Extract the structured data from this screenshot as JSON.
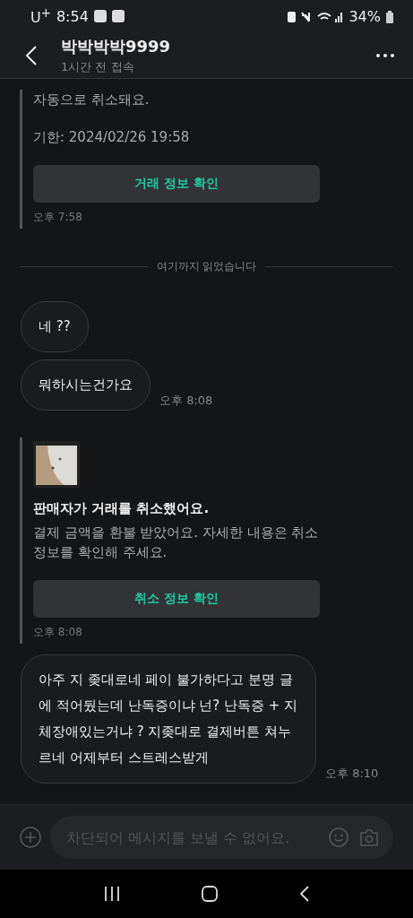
{
  "status_bar": {
    "carrier": "U$^{+}$",
    "time": "8:54",
    "battery": "34%"
  },
  "header": {
    "title": "박박박박9999",
    "subtitle": "1시간 전 접속"
  },
  "messages": [
    {
      "kind": "card",
      "body": [
        "자동으로 취소돼요.",
        "기한: 2024/02/26 19:58"
      ],
      "button": "거래 정보 확인",
      "time": "오후 7:58"
    },
    {
      "kind": "divider",
      "text": "여기까지 읽었습니다"
    },
    {
      "kind": "bubble",
      "text": "네 ??"
    },
    {
      "kind": "bubble",
      "text": "뭐하시는건가요",
      "time": "오후 8:08"
    },
    {
      "kind": "card",
      "thumbnail": {
        "kind": "picture"
      },
      "title": "판매자가 거래를 취소했어요.",
      "body": [
        "결제 금액을 환불 받았어요. 자세한 내용은 취소 정보를 확인해 주세요."
      ],
      "button": "취소 정보 확인",
      "time": "오후 8:08"
    },
    {
      "kind": "bubble",
      "text": "아주 지 좆대로네 페이 불가하다고 분명 글에 적어뒀는데 난독증이냐 넌? 난독증 + 지체장애있는거냐 ? 지좆대로 결제버튼 쳐누르네 어제부터 스트레스받게",
      "time": "오후 8:10"
    }
  ],
  "composer": {
    "placeholder": "차단되어 메시지를 보낼 수 없어요."
  }
}
